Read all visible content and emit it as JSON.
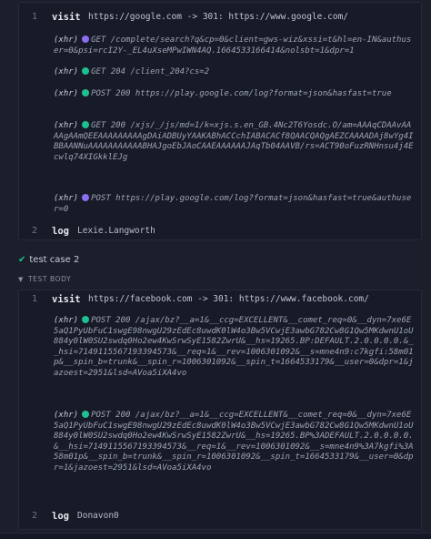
{
  "test_case_1": {
    "steps": [
      {
        "number": "1",
        "command": "visit",
        "url": "https://google.com -> 301: https://www.google.com/",
        "requests": [
          {
            "type": "(xhr)",
            "status_color": "#8b6cf2",
            "text": "GET /complete/search?q&cp=0&client=gws-wiz&xssi=t&hl=en-IN&authuser=0&psi=rcI2Y-_EL4uXseMPwIWN4AQ.1664533166414&nolsbt=1&dpr=1"
          },
          {
            "type": "(xhr)",
            "status_color": "#1fbf8f",
            "text": "GET 204 /client_204?cs=2"
          },
          {
            "type": "(xhr)",
            "status_color": "#1fbf8f",
            "text": "POST 200 https://play.google.com/log?format=json&hasfast=true"
          },
          {
            "type": "(xhr)",
            "status_color": "#1fbf8f",
            "text": "GET 200 /xjs/_/js/md=1/k=xjs.s.en_GB.4Nc2T6Yosdc.O/am=AAAqCDAAvAAAAgAAmQEEAAAAAAAAAgDAiADBUyYAAKABhACCchIABACACf8QAACQAQgAEZCAAAADAj8wYg4IBBAANNuAAAAAAAAAAABHAJgoEbJAoCAAEAAAAAAJAqTb04AAVB/rs=ACT90oFuzRNHnsu4j4Ecwlq74XIGkklEJg"
          },
          {
            "type": "(xhr)",
            "status_color": "#8b6cf2",
            "text": "POST https://play.google.com/log?format=json&hasfast=true&authuser=0"
          }
        ]
      },
      {
        "number": "2",
        "command": "log",
        "text": "Lexie.Langworth"
      }
    ]
  },
  "test_case_2": {
    "title": "test case 2",
    "status_icon": "check-icon",
    "section_label": "TEST BODY",
    "steps": [
      {
        "number": "1",
        "command": "visit",
        "url": "https://facebook.com -> 301: https://www.facebook.com/",
        "requests": [
          {
            "type": "(xhr)",
            "status_color": "#1fbf8f",
            "text": "POST 200 /ajax/bz?__a=1&__ccg=EXCELLENT&__comet_req=0&__dyn=7xe6E5aQ1PyUbFuC1swgE98nwgU29zEdEc8uwdK0lW4o3Bw5VCwjE3awbG782Cw8G1Qw5MKdwnU1oU884y0lW0SU2swdq0Ho2ew4KwSrwSyE1582ZwrU&__hs=19265.BP:DEFAULT.2.0.0.0.0.&__hsi=7149115567193394573&__req=1&__rev=1006301092&__s=mne4n9:c7kgfi:58m01p&__spin_b=trunk&__spin_r=1006301092&__spin_t=1664533179&__user=0&dpr=1&jazoest=2951&lsd=AVoa5iXA4vo"
          },
          {
            "type": "(xhr)",
            "status_color": "#1fbf8f",
            "text": "POST 200 /ajax/bz?__a=1&__ccg=EXCELLENT&__comet_req=0&__dyn=7xe6E5aQ1PyUbFuC1swgE98nwgU29zEdEc8uwdK0lW4o3Bw5VCwjE3awbG782Cw8G1Qw5MKdwnU1oU884y0lW0SU2swdq0Ho2ew4KwSrwSyE1582ZwrU&__hs=19265.BP%3ADEFAULT.2.0.0.0.0.&__hsi=7149115567193394573&__req=1&__rev=1006301092&__s=mne4n9%3A7kgfi%3A58m01p&__spin_b=trunk&__spin_r=1006301092&__spin_t=1664533179&__user=0&dpr=1&jazoest=2951&lsd=AVoa5iXA4vo"
          }
        ]
      },
      {
        "number": "2",
        "command": "log",
        "text": "Donavon0"
      }
    ]
  }
}
